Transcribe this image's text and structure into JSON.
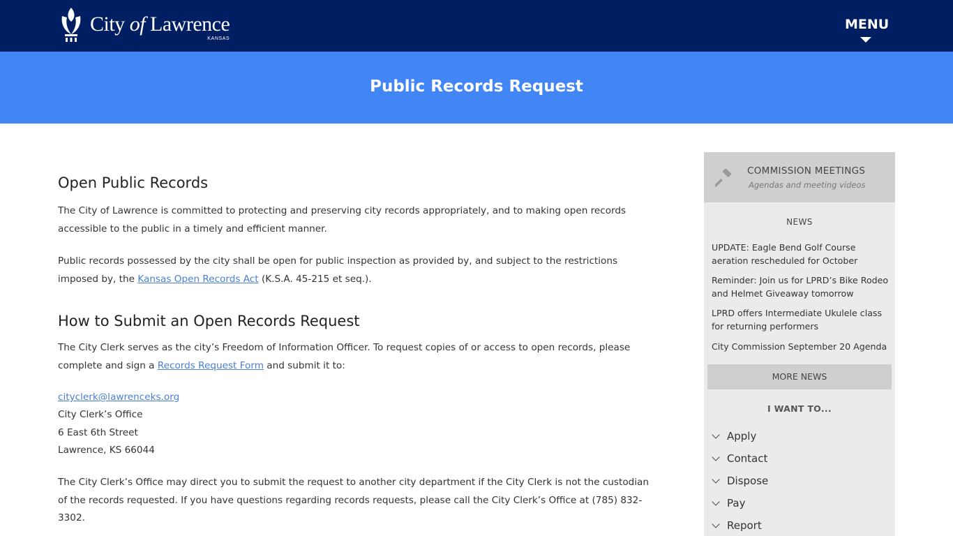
{
  "header": {
    "logo": {
      "city": "City",
      "of": "of",
      "name": "Lawrence",
      "state": "KANSAS"
    },
    "menu_label": "MENU"
  },
  "banner": {
    "title": "Public Records Request"
  },
  "main": {
    "open_heading": "Open Public Records",
    "p1": "The City of Lawrence is committed to protecting and preserving city records appropriately, and to making open records accessible to the public in a timely and efficient manner.",
    "p2_before": "Public records possessed by the city shall be open for public inspection as provided by, and subject to the restrictions imposed by, the ",
    "p2_link": "Kansas Open Records Act",
    "p2_after": " (K.S.A. 45-215 et seq.).",
    "submit_heading": "How to Submit an Open Records Request",
    "p3_before": "The City Clerk serves as the city’s Freedom of Information Officer. To request copies of or access to open records, please complete and sign a ",
    "p3_link": "Records Request Form",
    "p3_after": " and submit it to:",
    "address": {
      "email": "cityclerk@lawrenceks.org",
      "office": "City Clerk’s Office",
      "street": "6 East 6th Street",
      "city_line": "Lawrence, KS 66044"
    },
    "p4": "The City Clerk’s Office may direct you to submit the request to another city department if the City Clerk is not the custodian of the records requested. If you have questions regarding records requests, please call the City Clerk’s Office at (785) 832-3302."
  },
  "sidebar": {
    "commission": {
      "title": "COMMISSION MEETINGS",
      "subtitle": "Agendas and meeting videos",
      "icon": "gavel-icon"
    },
    "news_heading": "NEWS",
    "news": [
      "UPDATE: Eagle Bend Golf Course aeration rescheduled for October",
      "Reminder: Join us for LPRD’s Bike Rodeo and Helmet Giveaway tomorrow",
      "LPRD offers Intermediate Ukulele class for returning performers",
      "City Commission September 20 Agenda"
    ],
    "more_news": "MORE NEWS",
    "iwant_heading": "I WANT TO...",
    "iwant_items": [
      "Apply",
      "Contact",
      "Dispose",
      "Pay",
      "Report"
    ]
  },
  "colors": {
    "header_bg": "#001e62",
    "banner_bg": "#4285f4",
    "link": "#4a7fd4",
    "sidebar_bg": "#ebebeb",
    "sidebar_block": "#cfcfcf"
  }
}
